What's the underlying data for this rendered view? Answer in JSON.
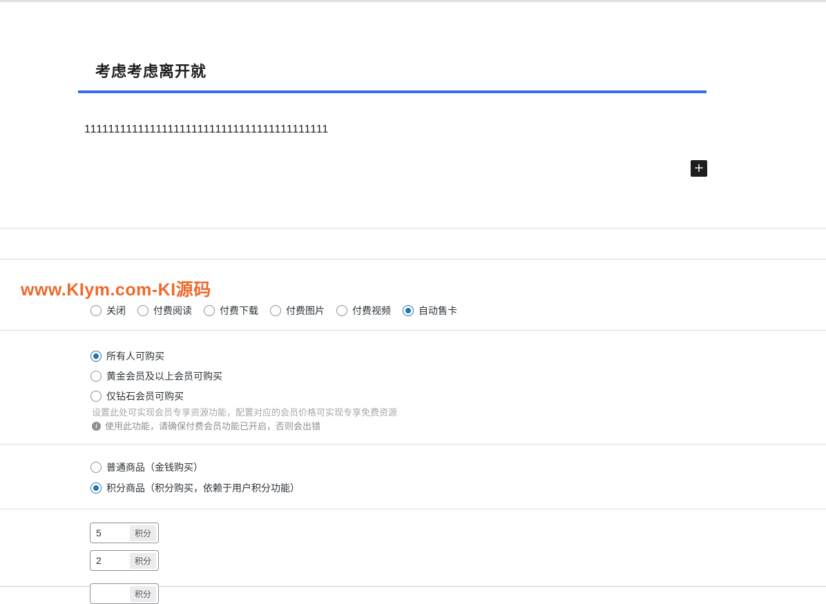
{
  "colors": {
    "accent_blue": "#386bf3",
    "radio_blue": "#2271b1",
    "watermark_orange": "#ed6a2c",
    "add_button_dark": "#1e1e1e",
    "divider_gray": "#dcdcde"
  },
  "editor": {
    "title": "考虑考虑离开就",
    "body_text": "11111111111111111111111111111111111111111",
    "add_block_label": "+"
  },
  "watermark": {
    "text": "www.KIym.com-KI源码"
  },
  "pay_type": {
    "options": [
      {
        "label": "关闭",
        "selected": false
      },
      {
        "label": "付费阅读",
        "selected": false
      },
      {
        "label": "付费下载",
        "selected": false
      },
      {
        "label": "付费图片",
        "selected": false
      },
      {
        "label": "付费视频",
        "selected": false
      },
      {
        "label": "自动售卡",
        "selected": true
      }
    ]
  },
  "access": {
    "options": [
      {
        "label": "所有人可购买",
        "selected": true
      },
      {
        "label": "黄金会员及以上会员可购买",
        "selected": false
      },
      {
        "label": "仅钻石会员可购买",
        "selected": false
      }
    ],
    "help_line1": "设置此处可实现会员专享资源功能，配置对应的会员价格可实现专享免费资源",
    "info_icon": "i",
    "help_line2": "使用此功能，请确保付费会员功能已开启，否则会出错"
  },
  "product_type": {
    "options": [
      {
        "label": "普通商品（金钱购买）",
        "selected": false
      },
      {
        "label": "积分商品（积分购买，依赖于用户积分功能）",
        "selected": true
      }
    ]
  },
  "points": {
    "inputs": [
      {
        "value": "5",
        "suffix": "积分"
      },
      {
        "value": "2",
        "suffix": "积分"
      },
      {
        "value": "",
        "suffix": "积分"
      }
    ]
  }
}
